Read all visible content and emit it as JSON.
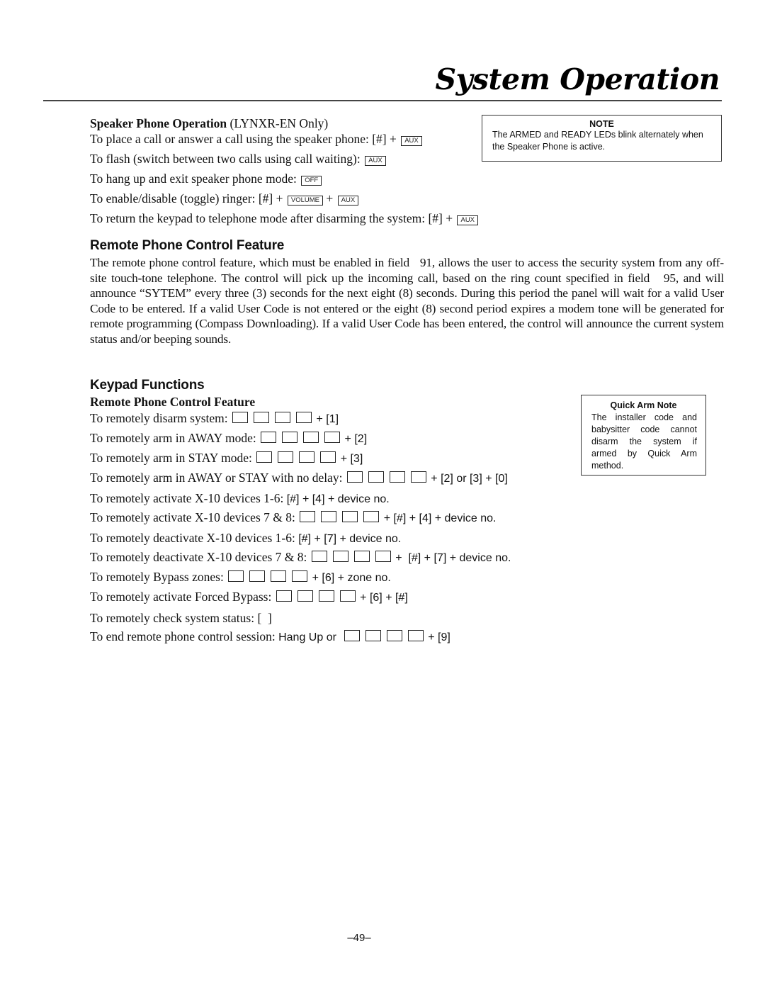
{
  "header": {
    "title": "System Operation"
  },
  "speaker_phone": {
    "heading": "Speaker Phone Operation",
    "heading_suffix": " (LYNXR-EN Only)",
    "lines": [
      {
        "text": "To place a call or answer a call using the speaker phone: [#] + ",
        "keys": [
          "AUX"
        ]
      },
      {
        "text": "To flash (switch between two calls using call waiting): ",
        "keys": [
          "AUX"
        ]
      },
      {
        "text": "To hang up and exit speaker phone mode: ",
        "keys": [
          "OFF"
        ]
      },
      {
        "text": "To enable/disable (toggle) ringer: [#] + ",
        "keys": [
          "VOLUME",
          "AUX"
        ],
        "joiner": " + "
      },
      {
        "text": "To return the keypad to telephone mode after disarming the system: [#] + ",
        "keys": [
          "AUX"
        ]
      }
    ]
  },
  "note": {
    "title": "NOTE",
    "body": "The ARMED and READY LEDs blink alternately when the Speaker Phone is active."
  },
  "remote_phone": {
    "heading": "Remote Phone Control Feature",
    "paragraph": "The remote phone control feature, which must be enabled in field   91, allows the user to access the security system from any off-site touch-tone telephone. The control will pick up the incoming call, based on the ring count specified in field   95, and will announce “SYTEM” every three (3) seconds for the next eight (8) seconds. During this period the panel will wait for a valid User Code to be entered. If a valid User Code is not entered or the eight (8) second period expires a modem tone will be generated for remote programming (Compass Downloading). If a valid User Code has been entered, the control will announce the current system status and/or beeping sounds."
  },
  "keypad_functions": {
    "heading": "Keypad Functions",
    "subheading": "Remote Phone Control Feature",
    "rows": [
      {
        "label": "To remotely disarm system: ",
        "code": true,
        "suffix": " + [1]"
      },
      {
        "label": "To remotely arm in AWAY mode: ",
        "code": true,
        "suffix": " + [2]"
      },
      {
        "label": "To remotely arm in STAY mode: ",
        "code": true,
        "suffix": " + [3]"
      },
      {
        "label": "To remotely arm in AWAY or STAY with no delay: ",
        "code": true,
        "suffix": " + [2] or [3] + [0]"
      },
      {
        "label": "To remotely activate X-10 devices 1-6: ",
        "code": false,
        "suffix": "[#] + [4] + device no."
      },
      {
        "label": "To remotely activate X-10 devices 7 & 8: ",
        "code": true,
        "suffix": " + [#] + [4] + device no."
      },
      {
        "label": "To remotely deactivate X-10 devices 1-6: ",
        "code": false,
        "suffix": "[#] + [7] + device no."
      },
      {
        "label": "To remotely deactivate X-10 devices 7 & 8: ",
        "code": true,
        "suffix": " +  [#] + [7] + device no."
      },
      {
        "label": "To remotely Bypass zones: ",
        "code": true,
        "suffix": " + [6] + zone no."
      },
      {
        "label": "To remotely activate Forced Bypass: ",
        "code": true,
        "suffix": " + [6] + [#]"
      },
      {
        "label": "To remotely check system status: ",
        "code": false,
        "suffix": "[  ]",
        "suffix_serif": true
      },
      {
        "label": "To end remote phone control session: ",
        "code": true,
        "prefix": "Hang Up or  ",
        "suffix": " + [9]"
      }
    ]
  },
  "quick_arm_note": {
    "title": "Quick Arm Note",
    "body": "The installer code and babysitter code cannot disarm the system if armed by Quick Arm method."
  },
  "footer": {
    "page_number": "–49–"
  }
}
